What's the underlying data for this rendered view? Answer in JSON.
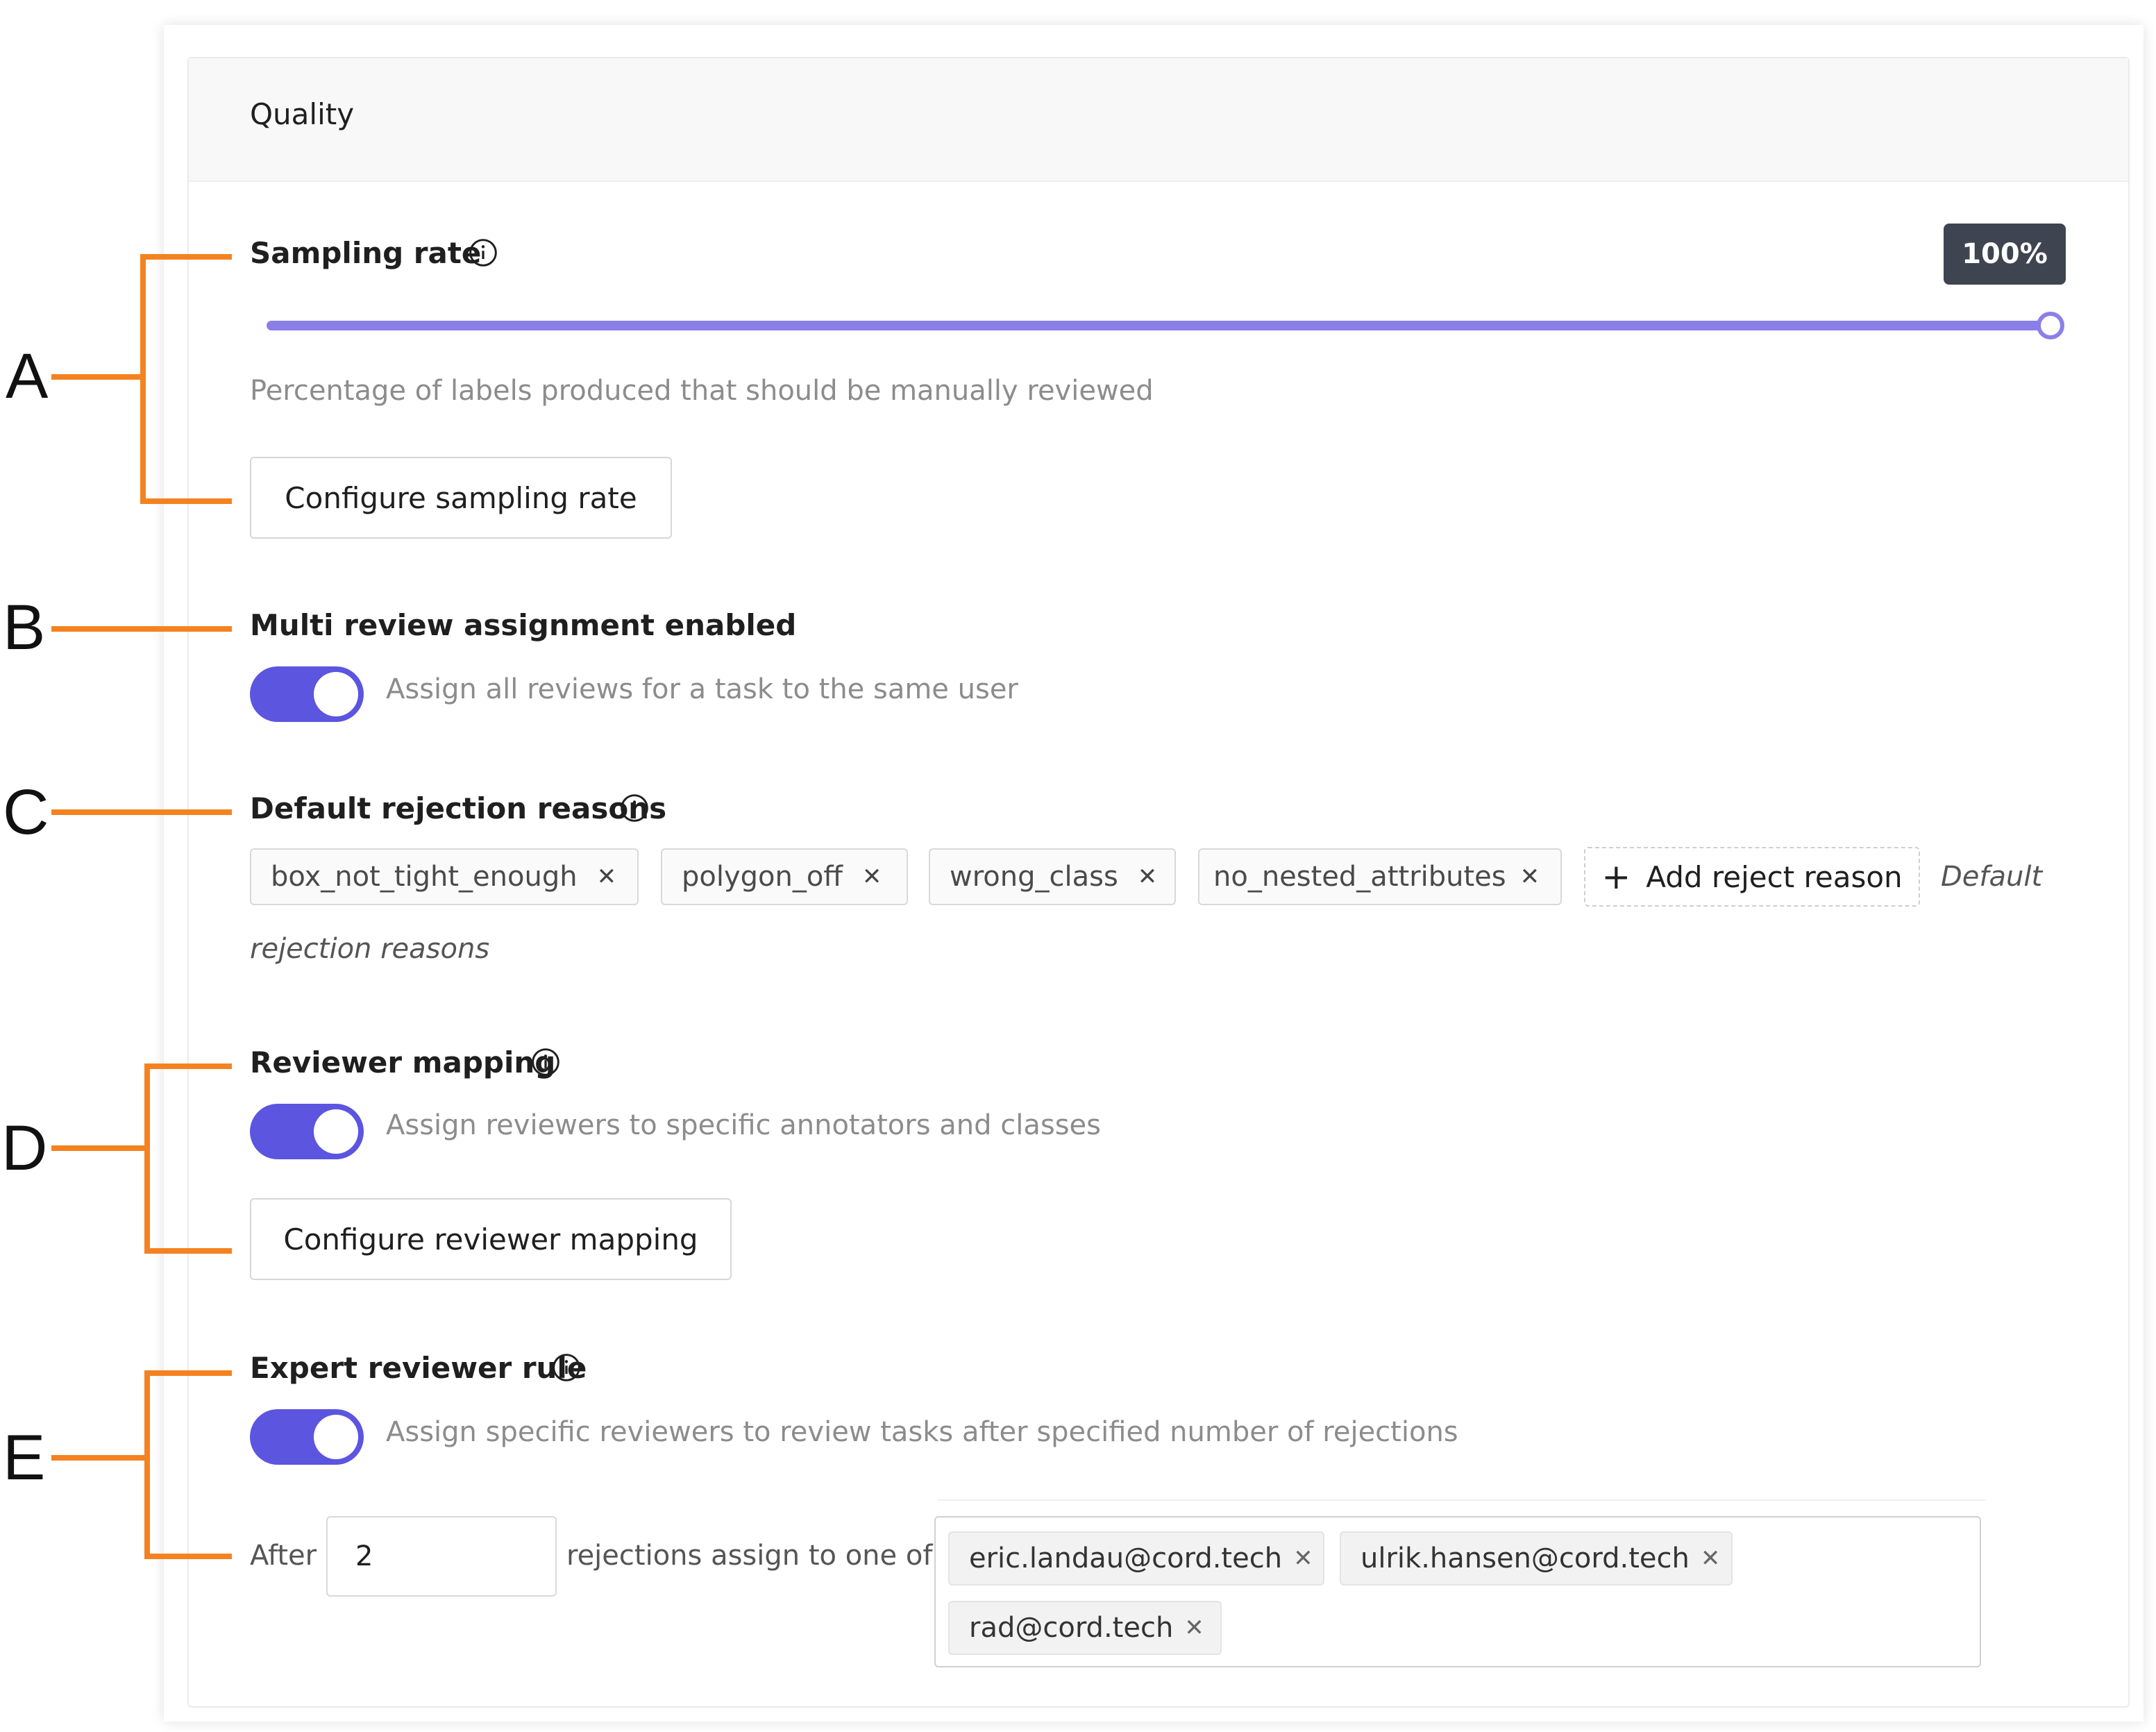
{
  "panel": {
    "title": "Quality"
  },
  "callouts": {
    "a": "A",
    "b": "B",
    "c": "C",
    "d": "D",
    "e": "E"
  },
  "sampling": {
    "title": "Sampling rate",
    "value_label": "100%",
    "value_fraction": 1.0,
    "description": "Percentage of labels produced that should be manually reviewed",
    "configure_label": "Configure sampling rate"
  },
  "multi_review": {
    "title": "Multi review assignment enabled",
    "enabled": true,
    "description": "Assign all reviews for a task to the same user"
  },
  "rejection": {
    "title": "Default rejection reasons",
    "tags": [
      "box_not_tight_enough",
      "polygon_off",
      "wrong_class",
      "no_nested_attributes"
    ],
    "add_label": "Add reject reason",
    "note_line1": "Default",
    "note_line2": "rejection reasons"
  },
  "reviewer_mapping": {
    "title": "Reviewer mapping",
    "enabled": true,
    "description": "Assign reviewers to specific annotators and classes",
    "configure_label": "Configure reviewer mapping"
  },
  "expert_rule": {
    "title": "Expert reviewer rule",
    "enabled": true,
    "description": "Assign specific reviewers to review tasks after specified number of rejections",
    "after_label": "After",
    "rejections_value": "2",
    "assign_label": "rejections assign to one of",
    "reviewers": [
      "eric.landau@cord.tech",
      "ulrik.hansen@cord.tech",
      "rad@cord.tech"
    ]
  },
  "colors": {
    "accent": "#5b55e0",
    "slider": "#8a7fe8",
    "badge_bg": "#3f4451",
    "callout": "#f58220"
  },
  "icons": {
    "info": "info-circle-icon",
    "close": "close-icon",
    "plus": "plus-icon"
  }
}
